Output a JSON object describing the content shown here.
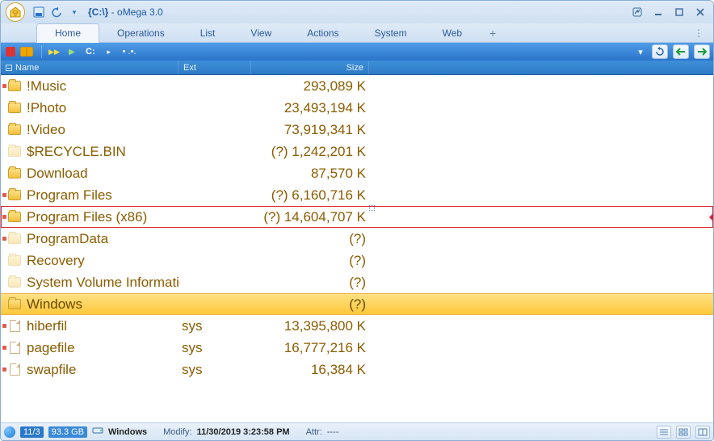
{
  "window": {
    "path": "{C:\\}",
    "sep": " - ",
    "app_name": "oMega 3.0"
  },
  "tabs": {
    "items": [
      "Home",
      "Operations",
      "List",
      "View",
      "Actions",
      "System",
      "Web"
    ],
    "active_index": 0,
    "plus": "+"
  },
  "drivebar": {
    "play": "▶",
    "drive": "C:",
    "dots": "• .•.",
    "dropdown": "▾",
    "refresh": "↻",
    "back": "🡐",
    "fwd": "🡒"
  },
  "columns": {
    "name": "Name",
    "ext": "Ext",
    "size": "Size"
  },
  "rows": [
    {
      "name": "!Music",
      "ext": "",
      "size": "293,089 K",
      "type": "folder",
      "mark": true
    },
    {
      "name": "!Photo",
      "ext": "",
      "size": "23,493,194 K",
      "type": "folder",
      "mark": false
    },
    {
      "name": "!Video",
      "ext": "",
      "size": "73,919,341 K",
      "type": "folder",
      "mark": false
    },
    {
      "name": "$RECYCLE.BIN",
      "ext": "",
      "size": "(?) 1,242,201 K",
      "type": "folder-faded",
      "mark": false
    },
    {
      "name": "Download",
      "ext": "",
      "size": "87,570 K",
      "type": "folder",
      "mark": false
    },
    {
      "name": "Program Files",
      "ext": "",
      "size": "(?) 6,160,716 K",
      "type": "folder",
      "mark": true
    },
    {
      "name": "Program Files (x86)",
      "ext": "",
      "size": "(?) 14,604,707 K",
      "type": "folder",
      "mark": true,
      "box_selected": true
    },
    {
      "name": "ProgramData",
      "ext": "",
      "size": "(?)",
      "type": "folder-faded",
      "mark": true
    },
    {
      "name": "Recovery",
      "ext": "",
      "size": "(?)",
      "type": "folder-faded",
      "mark": false
    },
    {
      "name": "System Volume Information",
      "ext": "",
      "size": "(?)",
      "type": "folder-faded",
      "mark": false
    },
    {
      "name": "Windows",
      "ext": "",
      "size": "(?)",
      "type": "folder",
      "mark": false,
      "highlighted": true
    },
    {
      "name": "hiberfil",
      "ext": "sys",
      "size": "13,395,800 K",
      "type": "file",
      "mark": true
    },
    {
      "name": "pagefile",
      "ext": "sys",
      "size": "16,777,216 K",
      "type": "file",
      "mark": true
    },
    {
      "name": "swapfile",
      "ext": "sys",
      "size": "16,384 K",
      "type": "file",
      "mark": true
    }
  ],
  "status": {
    "selection": "11/3",
    "free": "93.3 GB",
    "drive_label": "Windows",
    "modify_label": "Modify:",
    "modify_value": "11/30/2019 3:23:58 PM",
    "attr_label": "Attr:",
    "attr_value": "----"
  }
}
